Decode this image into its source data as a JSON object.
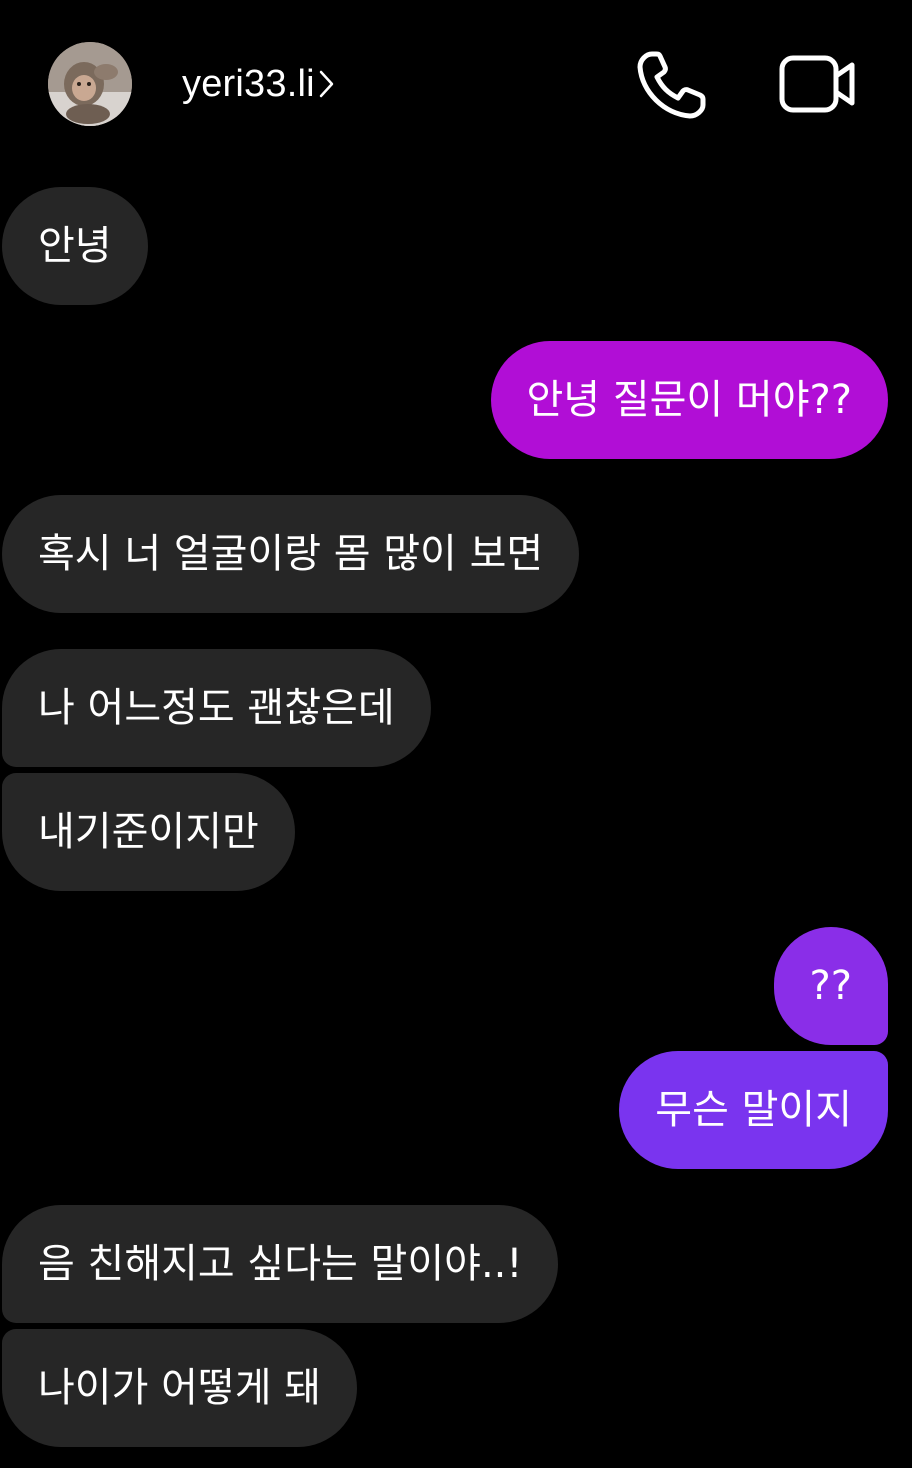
{
  "header": {
    "username": "yeri33.li",
    "icons": {
      "avatar": "profile-photo",
      "chevron": "chevron-right-icon",
      "call": "phone-icon",
      "video": "video-camera-icon"
    }
  },
  "colors": {
    "background": "#000000",
    "incoming_bubble": "#262626",
    "outgoing_magenta": "#b10ed6",
    "outgoing_violet_top": "#8a2ee8",
    "outgoing_violet_bottom": "#7a34ef"
  },
  "messages": [
    {
      "sender": "them",
      "text": "안녕"
    },
    {
      "sender": "me",
      "text": "안녕 질문이 머야??"
    },
    {
      "sender": "them",
      "text": "혹시 너 얼굴이랑 몸 많이 보면"
    },
    {
      "sender": "them",
      "text": "나 어느정도 괜찮은데"
    },
    {
      "sender": "them",
      "text": "내기준이지만"
    },
    {
      "sender": "me",
      "text": "??"
    },
    {
      "sender": "me",
      "text": "무슨 말이지"
    },
    {
      "sender": "them",
      "text": "음 친해지고 싶다는 말이야..!"
    },
    {
      "sender": "them",
      "text": "나이가 어떻게 돼"
    }
  ]
}
